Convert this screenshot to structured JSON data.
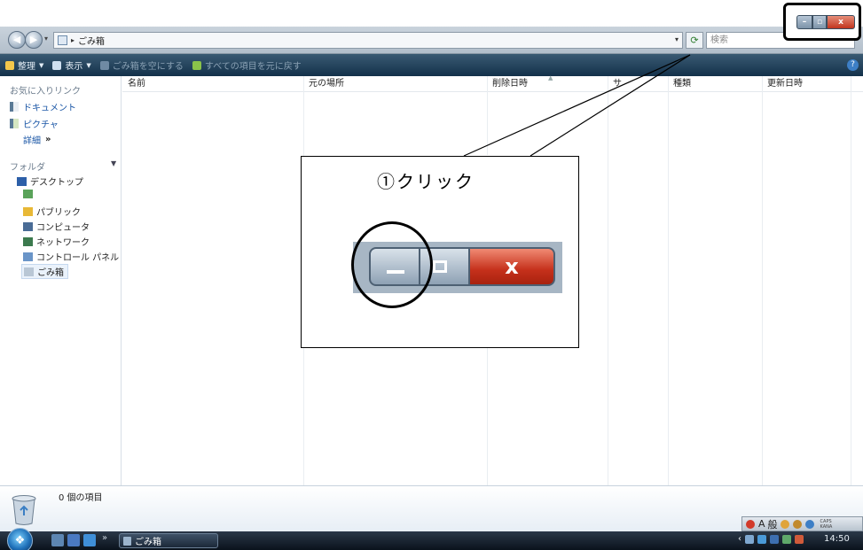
{
  "window": {
    "address_path": "ごみ箱",
    "search_placeholder": "検索"
  },
  "command_bar": {
    "items": [
      {
        "label": "整理",
        "icon": "organize-icon",
        "has_dropdown": true,
        "enabled": true
      },
      {
        "label": "表示",
        "icon": "views-icon",
        "has_dropdown": true,
        "enabled": true
      },
      {
        "label": "ごみ箱を空にする",
        "icon": "empty-recycle-bin-icon",
        "has_dropdown": false,
        "enabled": false
      },
      {
        "label": "すべての項目を元に戻す",
        "icon": "restore-icon",
        "has_dropdown": false,
        "enabled": false
      }
    ],
    "help_label": "?"
  },
  "nav_pane": {
    "favorites_title": "お気に入りリンク",
    "favorites": [
      {
        "label": "ドキュメント",
        "icon": "documents-icon"
      },
      {
        "label": "ピクチャ",
        "icon": "pictures-icon"
      },
      {
        "label": "詳細",
        "icon": "more-icon",
        "suffix": "»"
      }
    ],
    "folders_title": "フォルダ",
    "folders": [
      {
        "label": "デスクトップ",
        "icon": "desktop-icon",
        "selected": false
      },
      {
        "label": "",
        "icon": "user-folder-icon",
        "selected": false
      },
      {
        "label": "パブリック",
        "icon": "public-folder-icon",
        "selected": false
      },
      {
        "label": "コンピュータ",
        "icon": "computer-icon",
        "selected": false
      },
      {
        "label": "ネットワーク",
        "icon": "network-icon",
        "selected": false
      },
      {
        "label": "コントロール パネル",
        "icon": "control-panel-icon",
        "selected": false
      },
      {
        "label": "ごみ箱",
        "icon": "recycle-bin-icon",
        "selected": true
      }
    ]
  },
  "columns": [
    {
      "label": "名前"
    },
    {
      "label": "元の場所"
    },
    {
      "label": "削除日時"
    },
    {
      "label": "サ"
    },
    {
      "label": "種類"
    },
    {
      "label": "更新日時"
    }
  ],
  "details_pane": {
    "item_count": "0 個の項目"
  },
  "language_bar": {
    "mode": "A",
    "input": "般",
    "caps": "CAPS",
    "kana": "KANA"
  },
  "taskbar": {
    "start_label": "Start",
    "more": "»",
    "task_label": "ごみ箱",
    "clock": "14:50",
    "tray_arrow": "‹"
  },
  "callout": {
    "text": "①クリック",
    "close_glyph": "x"
  },
  "colors": {
    "command_bar": "#13314a",
    "close_button": "#c5301b",
    "link": "#1a56a6",
    "annotation": "#000000"
  }
}
